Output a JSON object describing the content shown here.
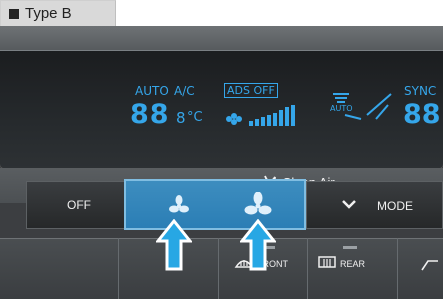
{
  "header": {
    "title": "Type B"
  },
  "display": {
    "auto": "AUTO",
    "ac": "A/C",
    "ads_off": "ADS OFF",
    "temp_digits": "88",
    "temp_small": "8",
    "temp_unit": "°C",
    "sync": "SYNC",
    "sync_digits": "88",
    "auto_small": "AUTO"
  },
  "clean_air": {
    "label": "Clean Air"
  },
  "buttons": {
    "off": "OFF",
    "mode": "MODE",
    "front": "FRONT",
    "rear": "REAR"
  },
  "colors": {
    "lcd": "#35a6ea",
    "highlight_button": "#2b7eb5",
    "arrow": "#27a7e4"
  }
}
